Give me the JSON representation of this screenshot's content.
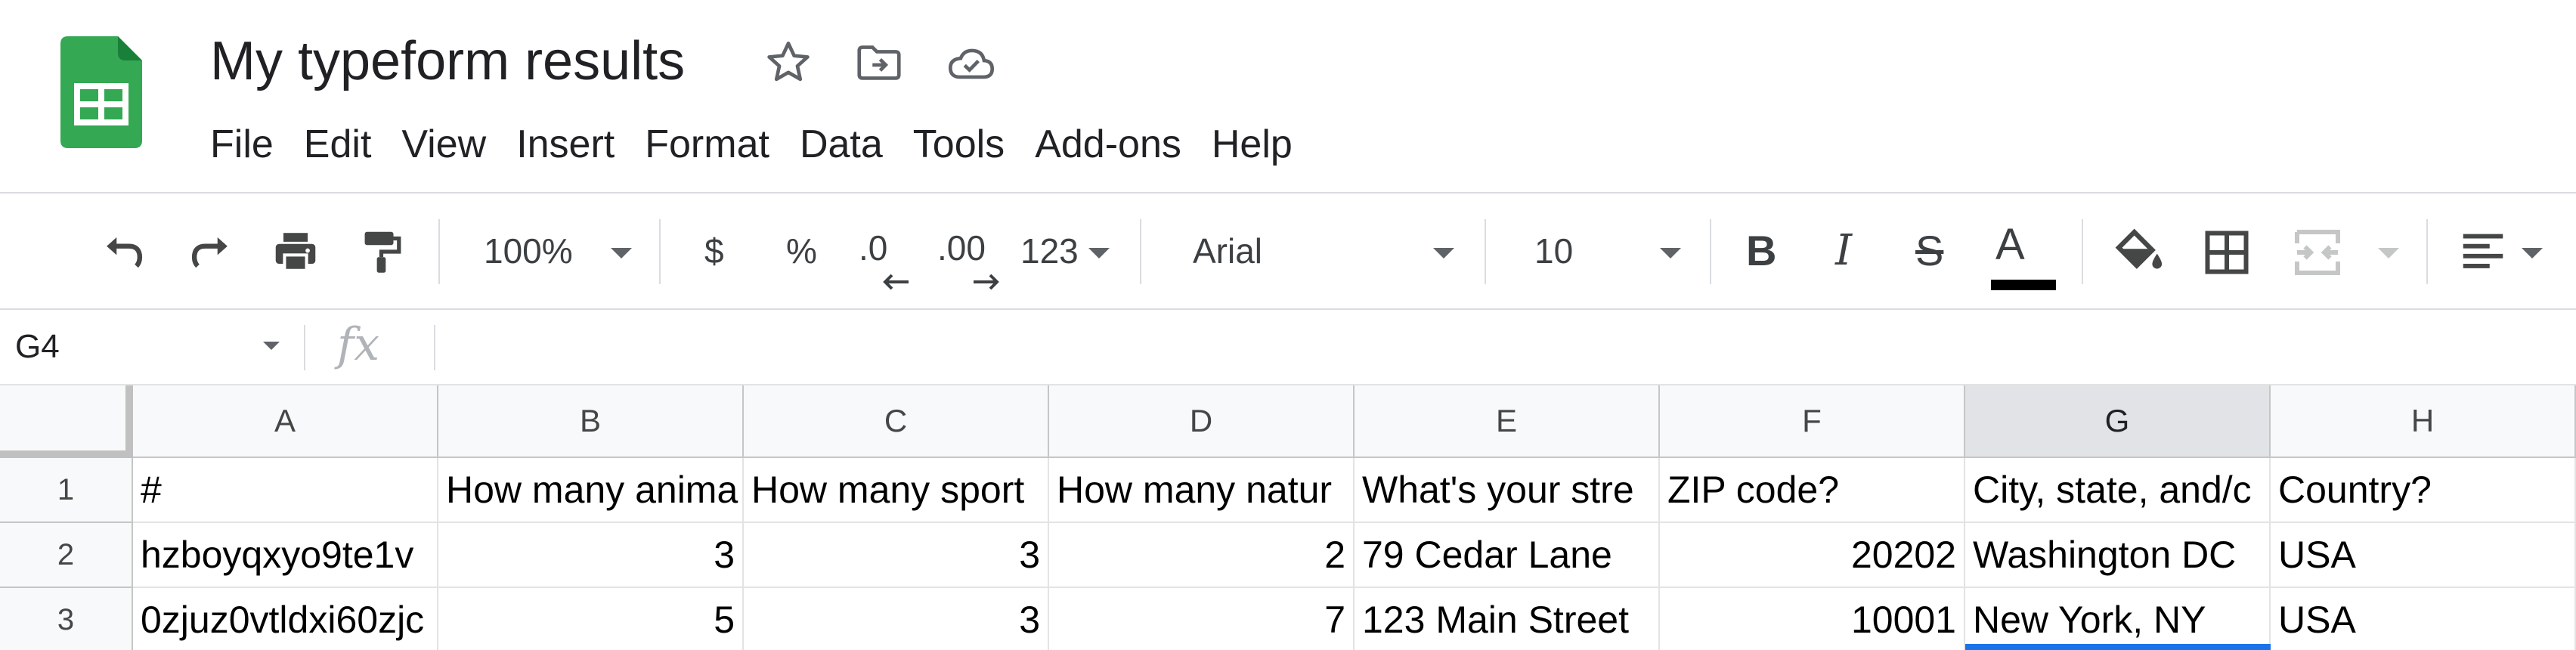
{
  "document": {
    "title": "My typeform results"
  },
  "menu": [
    "File",
    "Edit",
    "View",
    "Insert",
    "Format",
    "Data",
    "Tools",
    "Add-ons",
    "Help"
  ],
  "toolbar": {
    "zoom": "100%",
    "currency": "$",
    "percent": "%",
    "decrease_decimal": ".0",
    "increase_decimal": ".00",
    "more_formats": "123",
    "font": "Arial",
    "font_size": "10",
    "bold": "B",
    "italic": "I",
    "strikethrough": "S",
    "text_color_letter": "A"
  },
  "formula_bar": {
    "cell_ref": "G4",
    "fx": "fx",
    "content": ""
  },
  "colors": {
    "accent": "#1a73e8",
    "sheets_green": "#34a853",
    "sheets_dark_green": "#188038"
  },
  "grid": {
    "columns": [
      "A",
      "B",
      "C",
      "D",
      "E",
      "F",
      "G",
      "H"
    ],
    "selected_column": "G",
    "rows": [
      {
        "number": "1",
        "cells": [
          "#",
          "How many anima",
          "How many sport",
          "How many natur",
          "What's your stre",
          "ZIP code?",
          "City, state, and/c",
          "Country?"
        ]
      },
      {
        "number": "2",
        "cells": [
          "hzboyqxyo9te1v",
          "3",
          "3",
          "2",
          "79 Cedar Lane",
          "20202",
          "Washington DC",
          "USA"
        ]
      },
      {
        "number": "3",
        "cells": [
          "0zjuz0vtldxi60zjc",
          "5",
          "3",
          "7",
          "123 Main Street",
          "10001",
          "New York, NY",
          "USA"
        ]
      }
    ]
  }
}
